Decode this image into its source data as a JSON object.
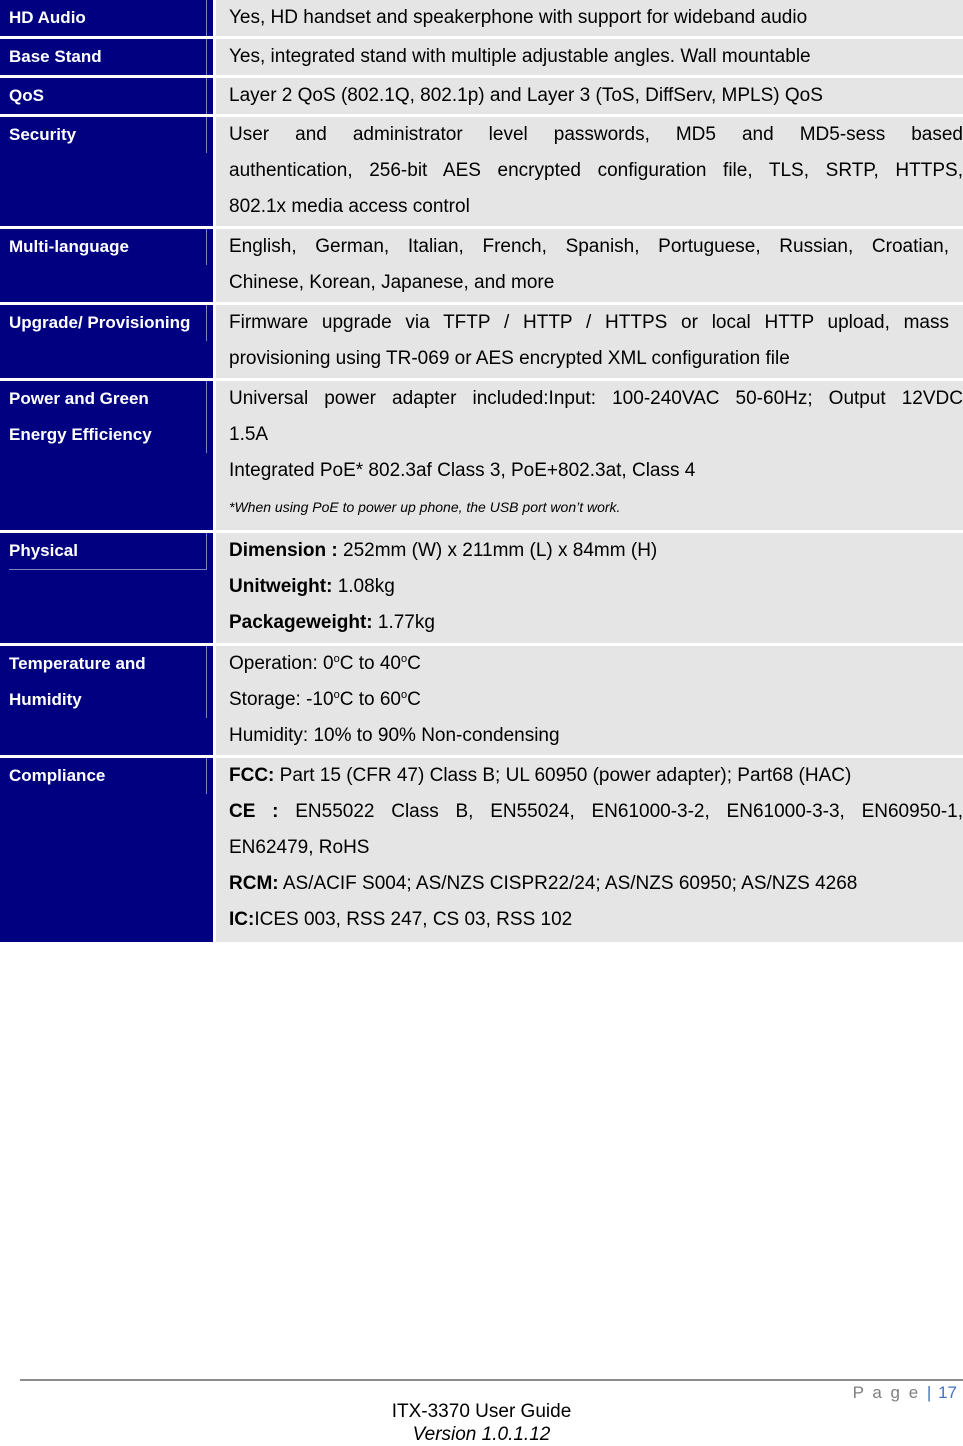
{
  "specs": [
    {
      "label": "HD Audio",
      "lines": [
        "Yes, HD handset and speakerphone with support for wideband audio"
      ]
    },
    {
      "label": "Base Stand",
      "lines": [
        "Yes, integrated stand with multiple adjustable angles. Wall mountable"
      ]
    },
    {
      "label": "QoS",
      "lines": [
        "Layer 2 QoS (802.1Q, 802.1p) and Layer 3 (ToS, DiffServ, MPLS) QoS"
      ]
    },
    {
      "label": "Security",
      "lines": [
        "User and administrator level passwords, MD5 and MD5-sess based",
        "authentication, 256-bit AES encrypted configuration file, TLS, SRTP, HTTPS,",
        "802.1x media access control"
      ]
    },
    {
      "label": "Multi-language",
      "lines": [
        "English, German, Italian, French, Spanish, Portuguese, Russian, Croatian,",
        "Chinese, Korean, Japanese, and more"
      ]
    },
    {
      "label": "Upgrade/ Provisioning",
      "lines": [
        "Firmware upgrade via TFTP / HTTP / HTTPS or local HTTP upload, mass",
        "provisioning using TR-069 or AES encrypted XML configuration file"
      ]
    },
    {
      "label_lines": [
        "Power and Green",
        "Energy Efficiency"
      ],
      "lines": [
        "Universal power adapter included:Input: 100-240VAC 50-60Hz; Output 12VDC",
        "1.5A",
        "Integrated PoE* 802.3af Class 3, PoE+802.3at, Class 4"
      ],
      "note": "*When using PoE to power up phone, the USB port won’t work."
    },
    {
      "label": "Physical",
      "items": [
        {
          "key": "Dimension :",
          "value": " 252mm (W) x 211mm (L) x 84mm (H)"
        },
        {
          "key": "Unitweight:",
          "value": " 1.08kg"
        },
        {
          "key": "Packageweight:",
          "value": " 1.77kg"
        }
      ]
    },
    {
      "label_lines": [
        "Temperature and",
        "Humidity"
      ],
      "temp": {
        "operation_prefix": "Operation: 0",
        "operation_mid": "C to 40",
        "operation_suffix": "C",
        "storage_prefix": "Storage: -10",
        "storage_mid": "C to 60",
        "storage_suffix": "C",
        "degree": "o",
        "humidity": "Humidity: 10% to 90% Non-condensing"
      }
    },
    {
      "label": "Compliance",
      "items": [
        {
          "key": "FCC:",
          "value": " Part 15 (CFR 47) Class B; UL 60950 (power adapter); Part68 (HAC)"
        },
        {
          "key": "CE :",
          "value": " EN55022 Class B, EN55024, EN61000-3-2, EN61000-3-3, EN60950-1,"
        },
        {
          "key": "",
          "value": "EN62479, RoHS"
        },
        {
          "key": "RCM:",
          "value": " AS/ACIF S004; AS/NZS CISPR22/24; AS/NZS 60950; AS/NZS 4268"
        },
        {
          "key": "IC:",
          "value": "ICES 003, RSS 247, CS 03, RSS 102"
        }
      ]
    }
  ],
  "footer": {
    "page_label": "P a g e",
    "separator": "|",
    "page_number": "17",
    "title": "ITX-3370 User Guide",
    "version": "Version 1.0.1.12"
  }
}
